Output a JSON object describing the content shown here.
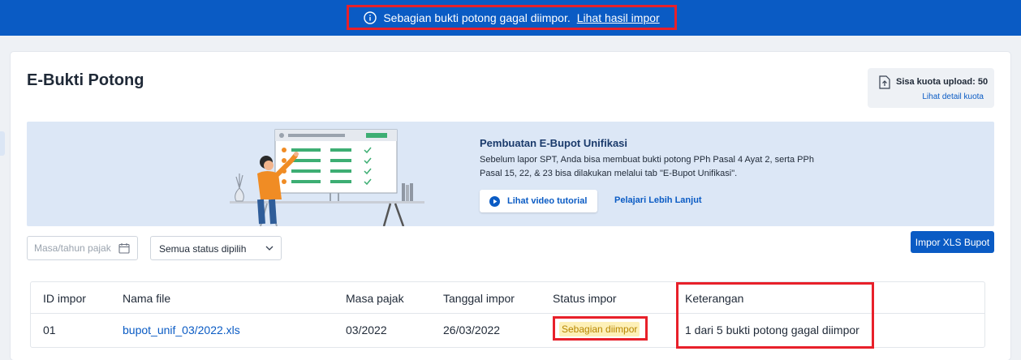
{
  "banner": {
    "icon": "info-icon",
    "message": "Sebagian bukti potong gagal diimpor.",
    "link": "Lihat hasil impor"
  },
  "page": {
    "title": "E-Bukti Potong"
  },
  "quota": {
    "icon": "upload-file-icon",
    "text": "Sisa kuota upload: 50",
    "link": "Lihat detail kuota"
  },
  "promo": {
    "title": "Pembuatan E-Bupot Unifikasi",
    "description": "Sebelum lapor SPT, Anda bisa membuat bukti potong PPh Pasal 4 Ayat 2, serta PPh Pasal 15, 22, & 23 bisa dilakukan melalui tab \"E-Bupot Unifikasi\".",
    "video_button": "Lihat video tutorial",
    "learn_more": "Pelajari Lebih Lanjut"
  },
  "filters": {
    "date_placeholder": "Masa/tahun pajak",
    "status_value": "Semua status dipilih"
  },
  "actions": {
    "import_button": "Impor XLS Bupot"
  },
  "table": {
    "headers": [
      "ID impor",
      "Nama file",
      "Masa pajak",
      "Tanggal impor",
      "Status impor",
      "Keterangan"
    ],
    "rows": [
      {
        "id": "01",
        "file": "bupot_unif_03/2022.xls",
        "period": "03/2022",
        "date": "26/03/2022",
        "status": "Sebagian diimpor",
        "note": "1 dari 5 bukti potong gagal diimpor"
      }
    ]
  },
  "colors": {
    "primary": "#0a5bc4",
    "highlight": "#e8202a",
    "badge_bg": "#fdf0b8",
    "badge_text": "#b78600"
  }
}
